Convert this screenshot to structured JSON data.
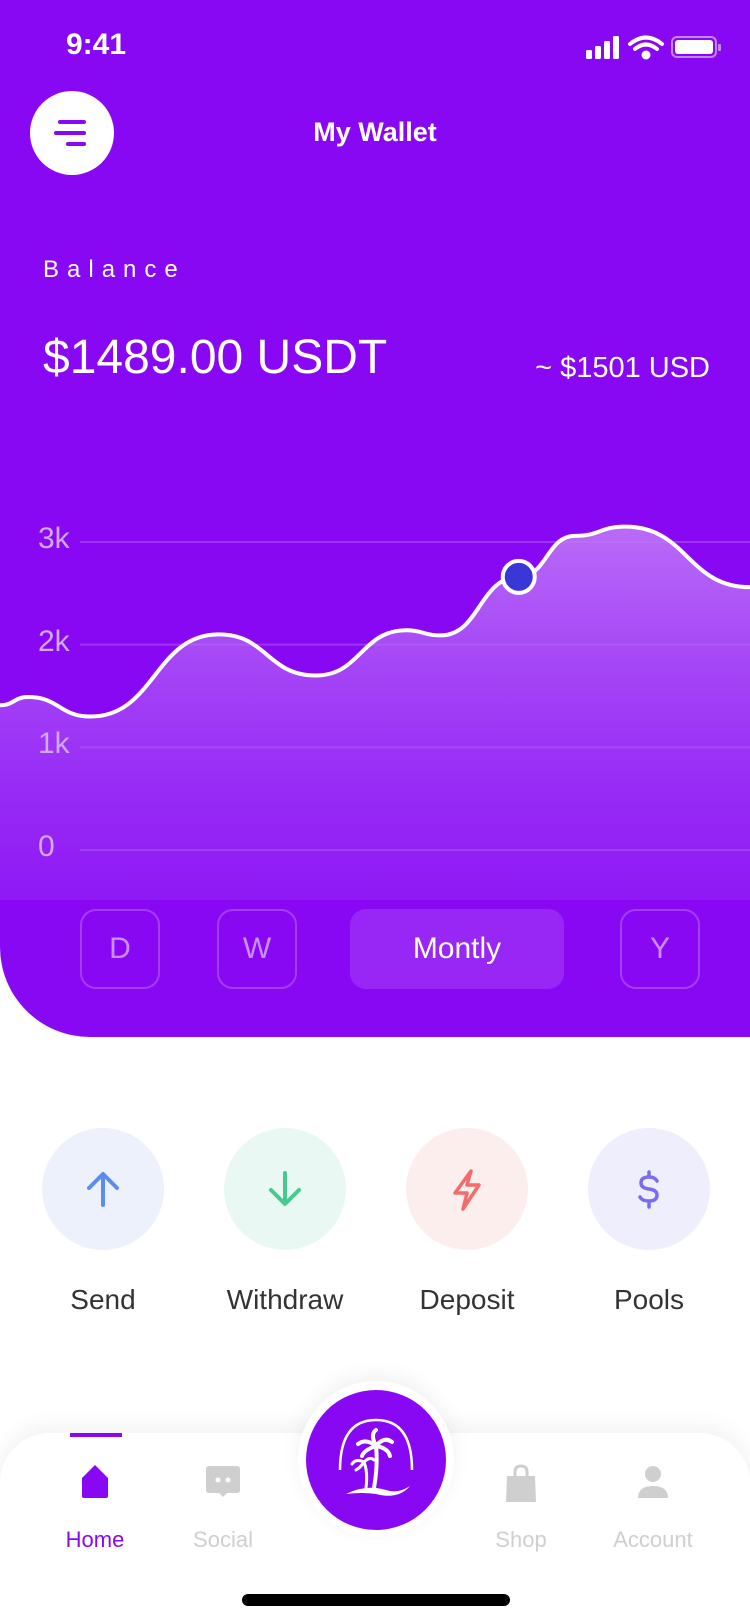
{
  "status": {
    "time": "9:41"
  },
  "header": {
    "title": "My Wallet"
  },
  "balance": {
    "label": "Balance",
    "amount": "$1489.00 USDT",
    "usd": "~ $1501 USD"
  },
  "chart_data": {
    "type": "area",
    "y_ticks": [
      "3k",
      "2k",
      "1k",
      "0"
    ],
    "y_tick_values": [
      3000,
      2000,
      1000,
      0
    ],
    "ylim": [
      0,
      3000
    ],
    "xlim": [
      0,
      12
    ],
    "grid": true,
    "x": [
      0,
      0.45,
      1.45,
      3.5,
      5.05,
      6.5,
      7.05,
      8.3,
      9.2,
      10.0,
      12.0
    ],
    "values": [
      1410,
      1490,
      1300,
      2100,
      1700,
      2140,
      2090,
      2660,
      3060,
      3150,
      2560
    ],
    "highlight": {
      "x": 8.3,
      "value": 2660
    },
    "colors": {
      "line": "#ffffff",
      "fill": "#b866f7",
      "marker": "#3a36d8"
    }
  },
  "periods": [
    {
      "label": "D",
      "active": false
    },
    {
      "label": "W",
      "active": false
    },
    {
      "label": "Montly",
      "active": true
    },
    {
      "label": "Y",
      "active": false
    }
  ],
  "actions": [
    {
      "label": "Send",
      "icon": "arrow-up-icon",
      "bg": "#ECF1FC",
      "color": "#5B8DEF"
    },
    {
      "label": "Withdraw",
      "icon": "arrow-down-icon",
      "bg": "#EAF8F3",
      "color": "#45C98F"
    },
    {
      "label": "Deposit",
      "icon": "lightning-icon",
      "bg": "#FDEEEE",
      "color": "#F46B6B"
    },
    {
      "label": "Pools",
      "icon": "dollar-icon",
      "bg": "#EFEEFD",
      "color": "#7A6CF0"
    }
  ],
  "nav": [
    {
      "label": "Home",
      "icon": "home-icon",
      "active": true
    },
    {
      "label": "Social",
      "icon": "chat-icon",
      "active": false
    },
    {
      "label": "Shop",
      "icon": "shopping-bag-icon",
      "active": false
    },
    {
      "label": "Account",
      "icon": "user-icon",
      "active": false
    }
  ],
  "colors": {
    "brand": "#8908F4",
    "inactive": "#cfcfcf"
  }
}
